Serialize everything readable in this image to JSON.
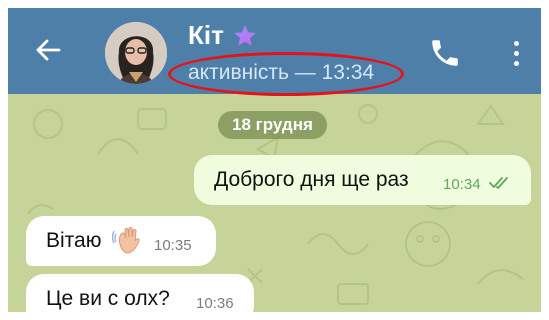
{
  "header": {
    "contact_name": "Кіт",
    "status": "активність — 13:34",
    "back_icon": "arrow-left-icon",
    "call_icon": "phone-icon",
    "menu_icon": "more-vertical-icon",
    "premium_icon": "star-icon"
  },
  "chat": {
    "date_label": "18 грудня",
    "messages": [
      {
        "direction": "out",
        "text": "Доброго дня ще раз",
        "time": "10:34",
        "status": "read"
      },
      {
        "direction": "in",
        "text": "Вітаю",
        "emoji": "waving-hand",
        "time": "10:35"
      },
      {
        "direction": "in",
        "text": "Це ви с олх?",
        "time": "10:36"
      }
    ]
  },
  "colors": {
    "header": "#4e7fa9",
    "chat_background": "#c6d49a",
    "outgoing_bubble": "#effdde",
    "incoming_bubble": "#ffffff",
    "annotation": "#e3131b",
    "read_check": "#5fa85b"
  }
}
